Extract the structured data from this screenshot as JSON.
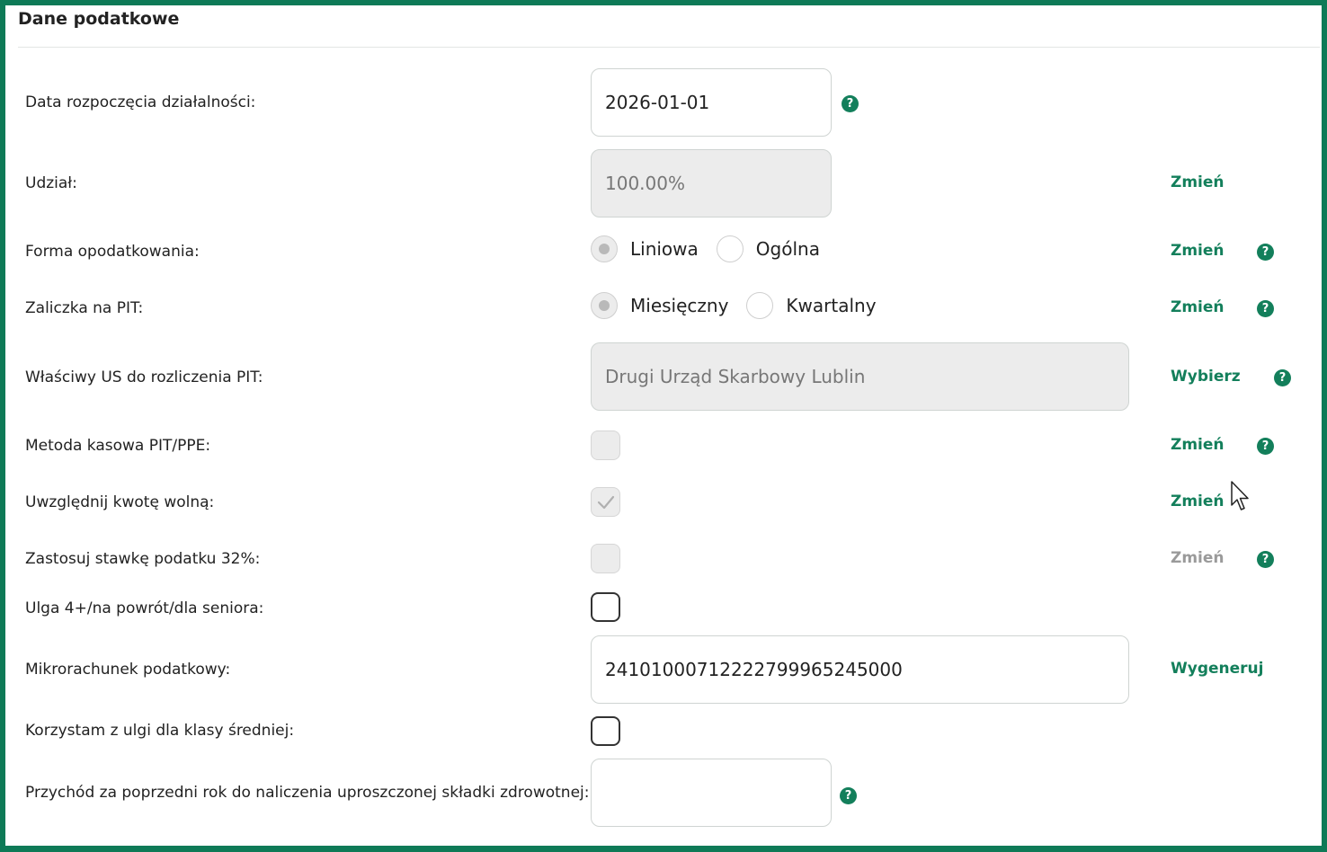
{
  "section": {
    "title": "Dane podatkowe"
  },
  "rows": {
    "start_date": {
      "label": "Data rozpoczęcia działalności:",
      "value": "2026-01-01"
    },
    "share": {
      "label": "Udział:",
      "value": "100.00%",
      "action": "Zmień"
    },
    "tax_form": {
      "label": "Forma opodatkowania:",
      "options": [
        "Liniowa",
        "Ogólna"
      ],
      "selected": "Liniowa",
      "action": "Zmień"
    },
    "pit_advance": {
      "label": "Zaliczka na PIT:",
      "options": [
        "Miesięczny",
        "Kwartalny"
      ],
      "selected": "Miesięczny",
      "action": "Zmień"
    },
    "tax_office": {
      "label": "Właściwy US do rozliczenia PIT:",
      "value": "Drugi Urząd Skarbowy Lublin",
      "action": "Wybierz"
    },
    "cash_method": {
      "label": "Metoda kasowa PIT/PPE:",
      "checked": false,
      "action": "Zmień"
    },
    "tax_free_amount": {
      "label": "Uwzględnij kwotę wolną:",
      "checked": true,
      "action": "Zmień"
    },
    "rate_32": {
      "label": "Zastosuj stawkę podatku 32%:",
      "checked": false,
      "action": "Zmień"
    },
    "relief_4plus": {
      "label": "Ulga 4+/na powrót/dla seniora:",
      "checked": false
    },
    "micro_account": {
      "label": "Mikrorachunek podatkowy:",
      "value": "24101000712222799965245000",
      "action": "Wygeneruj"
    },
    "middle_class_relief": {
      "label": "Korzystam z ulgi dla klasy średniej:",
      "checked": false
    },
    "prev_year_income": {
      "label": "Przychód za poprzedni rok do naliczenia uproszczonej składki zdrowotnej:",
      "value": ""
    }
  },
  "help_icon": "?",
  "colors": {
    "accent": "#137f5b",
    "frame": "#0e7a57",
    "disabled_bg": "#ececec",
    "disabled_link": "#9a9a9a"
  },
  "icons": {
    "help": "question-circle-icon",
    "check": "check-icon",
    "cursor": "mouse-pointer-icon"
  }
}
